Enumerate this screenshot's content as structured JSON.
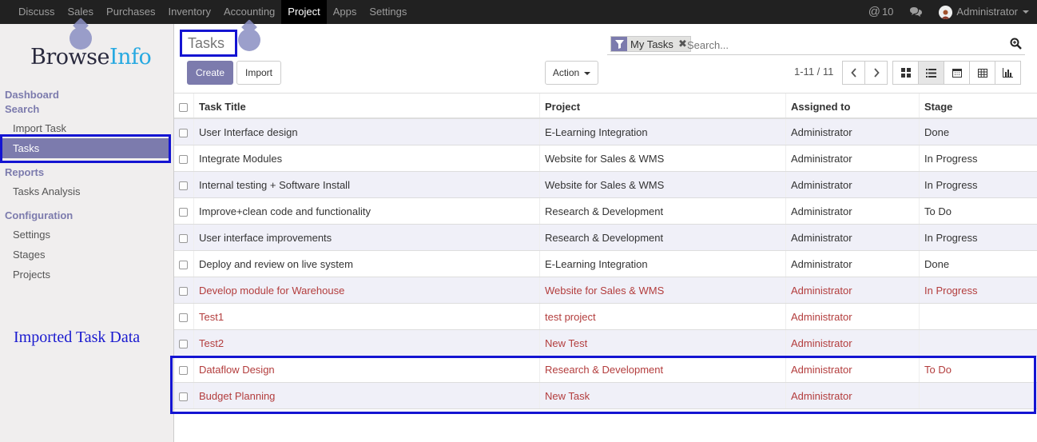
{
  "topbar": {
    "menu": [
      "Discuss",
      "Sales",
      "Purchases",
      "Inventory",
      "Accounting",
      "Project",
      "Apps",
      "Settings"
    ],
    "active_menu": "Project",
    "messages_count": "10",
    "user": "Administrator"
  },
  "brand": {
    "logo_part1": "Browse",
    "logo_part2": "Info"
  },
  "sidebar": {
    "dashboard": "Dashboard",
    "search": "Search",
    "import_task": "Import Task",
    "tasks": "Tasks",
    "reports": "Reports",
    "tasks_analysis": "Tasks Analysis",
    "configuration": "Configuration",
    "settings": "Settings",
    "stages": "Stages",
    "projects": "Projects",
    "note": "Imported Task Data"
  },
  "control": {
    "title": "Tasks",
    "facet": "My Tasks",
    "search_placeholder": "Search...",
    "create": "Create",
    "import": "Import",
    "action": "Action",
    "pager": "1-11 / 11"
  },
  "table": {
    "headers": [
      "Task Title",
      "Project",
      "Assigned to",
      "Stage"
    ],
    "rows": [
      {
        "title": "User Interface design",
        "project": "E-Learning Integration",
        "assigned": "Administrator",
        "stage": "Done"
      },
      {
        "title": "Integrate Modules",
        "project": "Website for Sales & WMS",
        "assigned": "Administrator",
        "stage": "In Progress"
      },
      {
        "title": "Internal testing + Software Install",
        "project": "Website for Sales & WMS",
        "assigned": "Administrator",
        "stage": "In Progress"
      },
      {
        "title": "Improve+clean code and functionality",
        "project": "Research & Development",
        "assigned": "Administrator",
        "stage": "To Do"
      },
      {
        "title": "User interface improvements",
        "project": "Research & Development",
        "assigned": "Administrator",
        "stage": "In Progress"
      },
      {
        "title": "Deploy and review on live system",
        "project": "E-Learning Integration",
        "assigned": "Administrator",
        "stage": "Done"
      },
      {
        "title": "Develop module for Warehouse",
        "project": "Website for Sales & WMS",
        "assigned": "Administrator",
        "stage": "In Progress"
      },
      {
        "title": "Test1",
        "project": "test project",
        "assigned": "Administrator",
        "stage": ""
      },
      {
        "title": "Test2",
        "project": "New Test",
        "assigned": "Administrator",
        "stage": ""
      },
      {
        "title": "Dataflow Design",
        "project": "Research & Development",
        "assigned": "Administrator",
        "stage": "To Do"
      },
      {
        "title": "Budget Planning",
        "project": "New Task",
        "assigned": "Administrator",
        "stage": ""
      }
    ]
  },
  "colors": {
    "accent": "#7c7bad",
    "overdue_text": "#b33d3d",
    "highlight": "#1414d2"
  }
}
